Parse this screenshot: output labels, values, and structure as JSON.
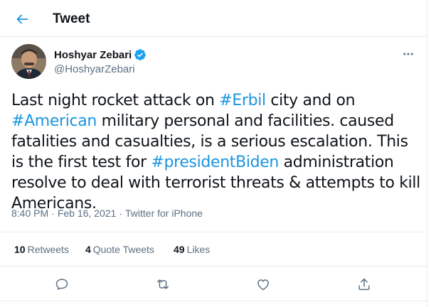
{
  "header": {
    "title": "Tweet",
    "back_icon": "back-arrow-icon"
  },
  "colors": {
    "accent": "#1b95e0",
    "text": "#0f1419",
    "secondary_text": "#5b7083",
    "border": "#e6ecf0"
  },
  "author": {
    "display_name": "Hoshyar Zebari",
    "handle": "@HoshyarZebari",
    "verified": true
  },
  "tweet": {
    "segments": [
      {
        "text": "Last night rocket attack on ",
        "hashtag": false
      },
      {
        "text": "#Erbil",
        "hashtag": true
      },
      {
        "text": " city and on ",
        "hashtag": false
      },
      {
        "text": "#American",
        "hashtag": true
      },
      {
        "text": " military personal and facilities. caused fatalities and casualties, is a serious escalation. This is the first test for ",
        "hashtag": false
      },
      {
        "text": "#presidentBiden",
        "hashtag": true
      },
      {
        "text": " administration resolve to deal with terrorist threats & attempts to kill Americans.",
        "hashtag": false
      }
    ]
  },
  "meta": {
    "time": "8:40 PM",
    "separator": "·",
    "date": "Feb 16, 2021",
    "source": "Twitter for iPhone"
  },
  "stats": {
    "retweets_count": "10",
    "retweets_label": "Retweets",
    "quotes_count": "4",
    "quotes_label": "Quote Tweets",
    "likes_count": "49",
    "likes_label": "Likes"
  },
  "actions": [
    "reply-icon",
    "retweet-icon",
    "like-icon",
    "share-icon"
  ]
}
